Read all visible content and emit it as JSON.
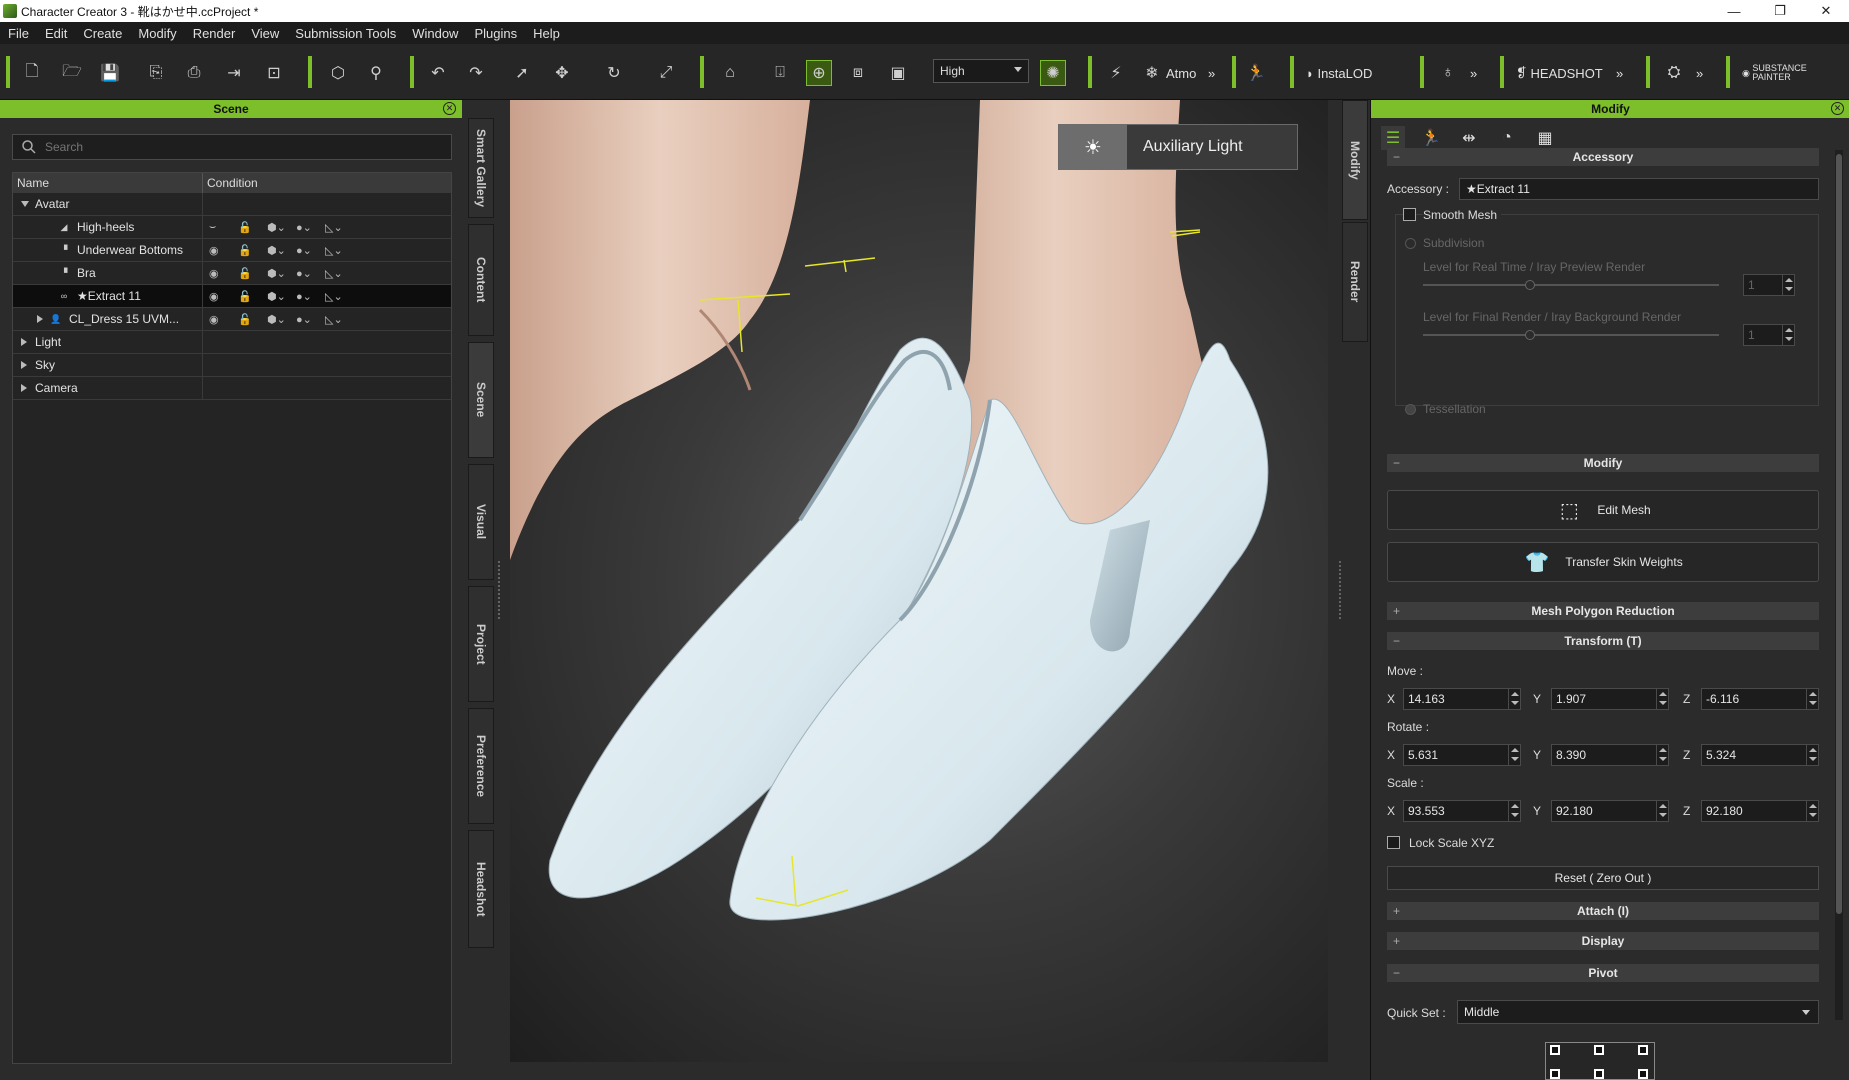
{
  "window": {
    "title": "Character Creator 3 - 靴はかせ中.ccProject *",
    "minimize": "—",
    "restore": "❐",
    "close": "✕"
  },
  "menu": [
    "File",
    "Edit",
    "Create",
    "Modify",
    "Render",
    "View",
    "Submission Tools",
    "Window",
    "Plugins",
    "Help"
  ],
  "toolbar": {
    "quality": "High",
    "atmo_label": "Atmo",
    "instalod_label": "InstaLOD",
    "headshot_label": "HEADSHOT",
    "substance_label": "SUBSTANCE PAINTER",
    "more": "»",
    "accent": "#7dbf2a"
  },
  "scene": {
    "title": "Scene",
    "search_placeholder": "Search",
    "col_name": "Name",
    "col_condition": "Condition",
    "avatar": "Avatar",
    "items": [
      {
        "name": "High-heels",
        "icon": "heel"
      },
      {
        "name": "Underwear Bottoms",
        "icon": "shirt"
      },
      {
        "name": "Bra",
        "icon": "shirt"
      },
      {
        "name": "★Extract 11",
        "icon": "link"
      },
      {
        "name": "CL_Dress 15 UVM...",
        "icon": "person"
      }
    ],
    "groups": [
      "Light",
      "Sky",
      "Camera"
    ]
  },
  "left_tabs": [
    "Smart Gallery",
    "Content",
    "Scene",
    "Visual",
    "Project",
    "Preference",
    "Headshot"
  ],
  "right_tabs": [
    "Modify",
    "Render"
  ],
  "viewport": {
    "aux_light": "Auxiliary Light"
  },
  "modify": {
    "title": "Modify",
    "accessory_section": "Accessory",
    "accessory_label": "Accessory :",
    "accessory_value": "★Extract 11",
    "smooth_mesh": "Smooth Mesh",
    "subdivision": "Subdivision",
    "level_realtime": "Level for Real Time / Iray Preview Render",
    "level_final": "Level for Final Render / Iray Background Render",
    "level_value_1": "1",
    "level_value_2": "1",
    "tessellation": "Tessellation",
    "modify_section": "Modify",
    "edit_mesh": "Edit Mesh",
    "transfer_skin": "Transfer Skin Weights",
    "mesh_reduction": "Mesh Polygon Reduction",
    "transform": "Transform  (T)",
    "move_label": "Move :",
    "rotate_label": "Rotate :",
    "scale_label": "Scale :",
    "x": "X",
    "y": "Y",
    "z": "Z",
    "move": {
      "x": "14.163",
      "y": "1.907",
      "z": "-6.116"
    },
    "rotate": {
      "x": "5.631",
      "y": "8.390",
      "z": "5.324"
    },
    "scale": {
      "x": "93.553",
      "y": "92.180",
      "z": "92.180"
    },
    "lock_scale": "Lock Scale XYZ",
    "reset": "Reset ( Zero Out )",
    "attach": "Attach  (I)",
    "display": "Display",
    "pivot": "Pivot",
    "quick_set_label": "Quick Set :",
    "quick_set_value": "Middle",
    "plus": "+",
    "minus": "−"
  }
}
